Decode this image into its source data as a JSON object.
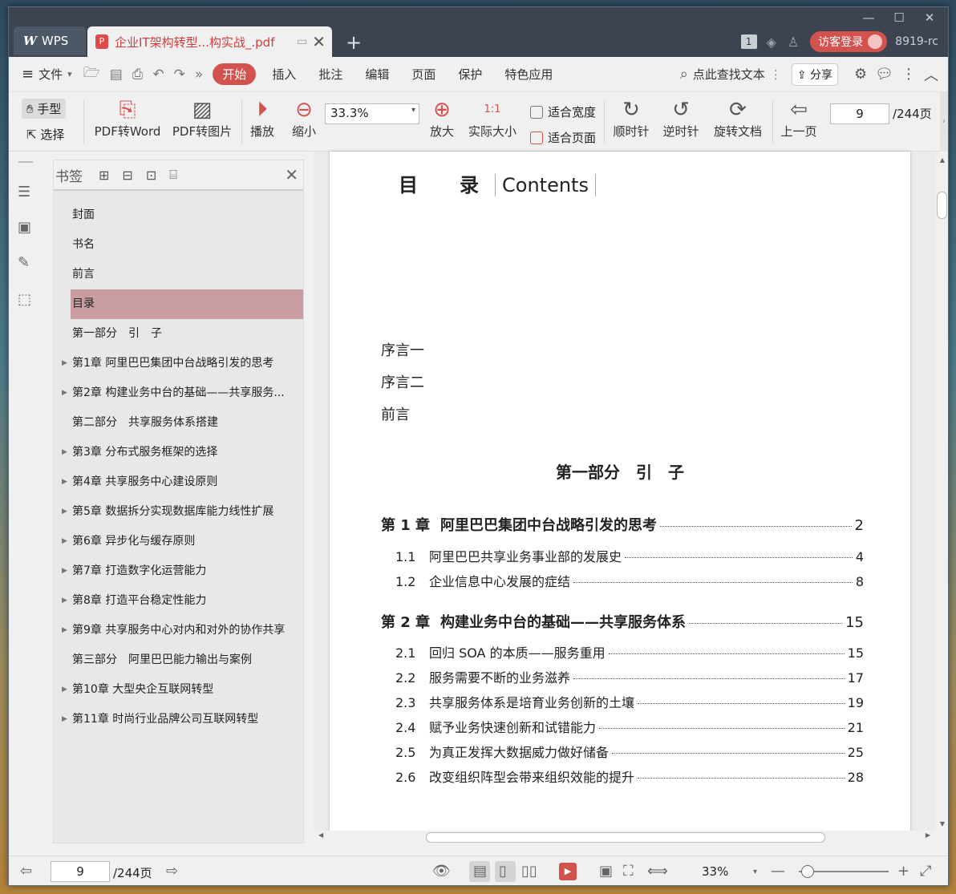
{
  "titlebar": {
    "app_tab": "WPS",
    "doc_tab": "企业IT架构转型...构实战_.pdf",
    "badge": "1",
    "login": "访客登录",
    "user_id": "8919-rc"
  },
  "menubar": {
    "file": "文件",
    "items": [
      "开始",
      "插入",
      "批注",
      "编辑",
      "页面",
      "保护",
      "特色应用"
    ],
    "search": "点此查找文本",
    "share": "分享"
  },
  "toolbar": {
    "hand": "手型",
    "select": "选择",
    "pdf_to_word": "PDF转Word",
    "pdf_to_image": "PDF转图片",
    "play": "播放",
    "zoom_out": "缩小",
    "zoom_value": "33.3%",
    "zoom_in": "放大",
    "actual_size": "实际大小",
    "fit_width": "适合宽度",
    "fit_page": "适合页面",
    "clockwise": "顺时针",
    "counterclockwise": "逆时针",
    "rotate_doc": "旋转文档",
    "prev_page": "上一页",
    "page_current": "9",
    "page_total": "/244页",
    "icon_actual": "1:1"
  },
  "bookmarks": {
    "title": "书签",
    "items": [
      {
        "label": "封面",
        "expandable": false
      },
      {
        "label": "书名",
        "expandable": false
      },
      {
        "label": "前言",
        "expandable": false
      },
      {
        "label": "目录",
        "expandable": false,
        "active": true
      },
      {
        "label": "第一部分　引　子",
        "expandable": false
      },
      {
        "label": "第1章 阿里巴巴集团中台战略引发的思考",
        "expandable": true
      },
      {
        "label": "第2章 构建业务中台的基础——共享服务...",
        "expandable": true
      },
      {
        "label": "第二部分　共享服务体系搭建",
        "expandable": false
      },
      {
        "label": "第3章 分布式服务框架的选择",
        "expandable": true
      },
      {
        "label": "第4章 共享服务中心建设原则",
        "expandable": true
      },
      {
        "label": "第5章 数据拆分实现数据库能力线性扩展",
        "expandable": true
      },
      {
        "label": "第6章 异步化与缓存原则",
        "expandable": true
      },
      {
        "label": "第7章 打造数字化运营能力",
        "expandable": true
      },
      {
        "label": "第8章 打造平台稳定性能力",
        "expandable": true
      },
      {
        "label": "第9章 共享服务中心对内和对外的协作共享",
        "expandable": true
      },
      {
        "label": "第三部分　阿里巴巴能力输出与案例",
        "expandable": false
      },
      {
        "label": "第10章 大型央企互联网转型",
        "expandable": true
      },
      {
        "label": "第11章 时尚行业品牌公司互联网转型",
        "expandable": true
      }
    ]
  },
  "page": {
    "title_cn": "目　录",
    "title_en": "Contents",
    "preface": [
      "序言一",
      "序言二",
      "前言"
    ],
    "part_title": "第一部分　引　子",
    "toc": [
      {
        "kind": "ch",
        "num": "第 1 章",
        "title": "阿里巴巴集团中台战略引发的思考",
        "page": "2"
      },
      {
        "kind": "sec",
        "num": "1.1",
        "title": "阿里巴巴共享业务事业部的发展史",
        "page": "4"
      },
      {
        "kind": "sec",
        "num": "1.2",
        "title": "企业信息中心发展的症结",
        "page": "8"
      },
      {
        "kind": "ch",
        "num": "第 2 章",
        "title": "构建业务中台的基础——共享服务体系",
        "page": "15"
      },
      {
        "kind": "sec",
        "num": "2.1",
        "title": "回归 SOA 的本质——服务重用",
        "page": "15"
      },
      {
        "kind": "sec",
        "num": "2.2",
        "title": "服务需要不断的业务滋养",
        "page": "17"
      },
      {
        "kind": "sec",
        "num": "2.3",
        "title": "共享服务体系是培育业务创新的土壤",
        "page": "19"
      },
      {
        "kind": "sec",
        "num": "2.4",
        "title": "赋予业务快速创新和试错能力",
        "page": "21"
      },
      {
        "kind": "sec",
        "num": "2.5",
        "title": "为真正发挥大数据威力做好储备",
        "page": "25"
      },
      {
        "kind": "sec",
        "num": "2.6",
        "title": "改变组织阵型会带来组织效能的提升",
        "page": "28"
      }
    ]
  },
  "statusbar": {
    "page_current": "9",
    "page_total": "/244页",
    "zoom": "33%",
    "zoom_level": 0.1
  }
}
